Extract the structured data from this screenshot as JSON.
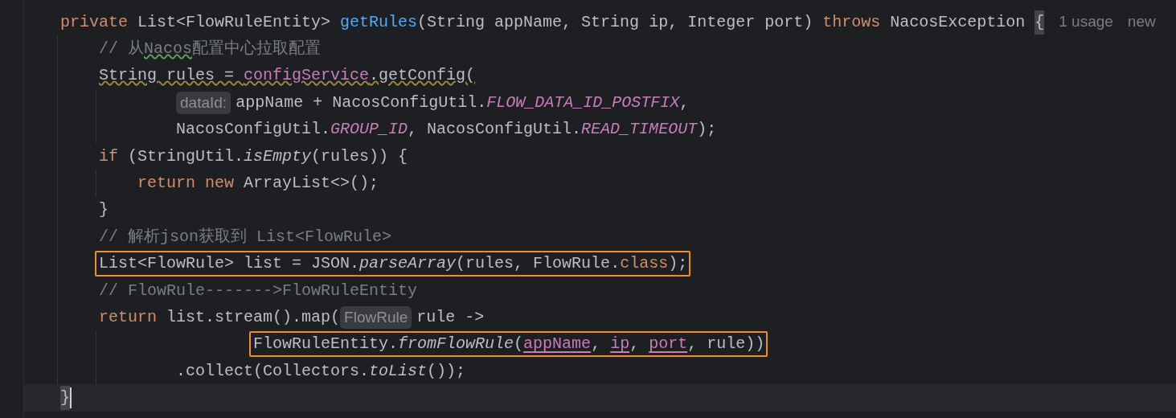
{
  "editor": {
    "lines": [
      {
        "kind": "statement",
        "current": false,
        "outlined": false,
        "warning": false,
        "tokens": [
          {
            "kind": "keyword",
            "text": "private"
          },
          {
            "kind": "plain",
            "text": " List<FlowRuleEntity> "
          },
          {
            "kind": "declaration",
            "text": "getRules"
          },
          {
            "kind": "plain",
            "text": "(String appName, String ip, Integer port) "
          },
          {
            "kind": "keyword",
            "text": "throws"
          },
          {
            "kind": "plain",
            "text": " NacosException "
          },
          {
            "kind": "brace",
            "text": "{"
          },
          {
            "kind": "usage",
            "text": "1 usage"
          },
          {
            "kind": "usage",
            "text": "new"
          }
        ],
        "children": [
          {
            "kind": "statement",
            "current": false,
            "outlined": false,
            "warning": false,
            "tokens": [
              {
                "kind": "comment",
                "text": "// 从",
                "misspelled": false
              },
              {
                "kind": "comment",
                "text": "Nacos",
                "misspelled": true
              },
              {
                "kind": "comment",
                "text": "配置中心拉取配置",
                "misspelled": false
              }
            ]
          },
          {
            "kind": "statement",
            "current": false,
            "outlined": false,
            "warning": true,
            "tokens": [
              {
                "kind": "plain",
                "text": "String rules = "
              },
              {
                "kind": "field",
                "text": "configService"
              },
              {
                "kind": "plain",
                "text": ".getConfig("
              }
            ],
            "children": [
              {
                "kind": "continuation",
                "current": false,
                "outlined": false,
                "warning": false,
                "tokens": [
                  {
                    "kind": "hint",
                    "text": "dataId:"
                  },
                  {
                    "kind": "plain",
                    "text": "appName + NacosConfigUtil."
                  },
                  {
                    "kind": "constant",
                    "text": "FLOW_DATA_ID_POSTFIX"
                  },
                  {
                    "kind": "plain",
                    "text": ","
                  }
                ]
              },
              {
                "kind": "continuation",
                "current": false,
                "outlined": false,
                "warning": false,
                "tokens": [
                  {
                    "kind": "plain",
                    "text": "NacosConfigUtil."
                  },
                  {
                    "kind": "constant",
                    "text": "GROUP_ID"
                  },
                  {
                    "kind": "plain",
                    "text": ", NacosConfigUtil."
                  },
                  {
                    "kind": "constant",
                    "text": "READ_TIMEOUT"
                  },
                  {
                    "kind": "plain",
                    "text": ");"
                  }
                ]
              }
            ]
          },
          {
            "kind": "statement",
            "current": false,
            "outlined": false,
            "warning": false,
            "tokens": [
              {
                "kind": "keyword",
                "text": "if"
              },
              {
                "kind": "plain",
                "text": " (StringUtil."
              },
              {
                "kind": "static-call",
                "text": "isEmpty"
              },
              {
                "kind": "plain",
                "text": "(rules)) {"
              }
            ],
            "children": [
              {
                "kind": "statement",
                "current": false,
                "outlined": false,
                "warning": false,
                "tokens": [
                  {
                    "kind": "keyword",
                    "text": "return new"
                  },
                  {
                    "kind": "plain",
                    "text": " ArrayList<>();"
                  }
                ]
              }
            ]
          },
          {
            "kind": "statement",
            "current": false,
            "outlined": false,
            "warning": false,
            "tokens": [
              {
                "kind": "plain",
                "text": "}"
              }
            ]
          },
          {
            "kind": "statement",
            "current": false,
            "outlined": false,
            "warning": false,
            "tokens": [
              {
                "kind": "comment",
                "text": "// 解析json获取到 List<FlowRule>"
              }
            ]
          },
          {
            "kind": "statement",
            "current": false,
            "outlined": true,
            "warning": false,
            "tokens": [
              {
                "kind": "plain",
                "text": "List<FlowRule> list = JSON."
              },
              {
                "kind": "static-call",
                "text": "parseArray"
              },
              {
                "kind": "plain",
                "text": "(rules, FlowRule."
              },
              {
                "kind": "keyword",
                "text": "class"
              },
              {
                "kind": "plain",
                "text": ");"
              }
            ]
          },
          {
            "kind": "statement",
            "current": false,
            "outlined": false,
            "warning": false,
            "tokens": [
              {
                "kind": "comment",
                "text": "// FlowRule------->FlowRuleEntity"
              }
            ]
          },
          {
            "kind": "statement",
            "current": false,
            "outlined": false,
            "warning": false,
            "tokens": [
              {
                "kind": "keyword",
                "text": "return"
              },
              {
                "kind": "plain",
                "text": " list.stream().map("
              },
              {
                "kind": "hint",
                "text": "FlowRule"
              },
              {
                "kind": "plain",
                "text": "rule ->"
              }
            ],
            "children": [
              {
                "kind": "lambda-body",
                "current": false,
                "outlined": true,
                "warning": false,
                "tokens": [
                  {
                    "kind": "plain",
                    "text": "FlowRuleEntity."
                  },
                  {
                    "kind": "static-call",
                    "text": "fromFlowRule"
                  },
                  {
                    "kind": "plain",
                    "text": "("
                  },
                  {
                    "kind": "param-ref",
                    "text": "appName"
                  },
                  {
                    "kind": "plain",
                    "text": ", "
                  },
                  {
                    "kind": "param-ref",
                    "text": "ip"
                  },
                  {
                    "kind": "plain",
                    "text": ", "
                  },
                  {
                    "kind": "param-ref",
                    "text": "port"
                  },
                  {
                    "kind": "plain",
                    "text": ", rule))"
                  }
                ]
              },
              {
                "kind": "continuation",
                "current": false,
                "outlined": false,
                "warning": false,
                "tokens": [
                  {
                    "kind": "plain",
                    "text": ".collect(Collectors."
                  },
                  {
                    "kind": "static-call",
                    "text": "toList"
                  },
                  {
                    "kind": "plain",
                    "text": "());"
                  }
                ]
              }
            ]
          }
        ]
      },
      {
        "kind": "statement",
        "current": true,
        "outlined": false,
        "warning": false,
        "tokens": [
          {
            "kind": "brace",
            "text": "}"
          }
        ]
      }
    ]
  }
}
